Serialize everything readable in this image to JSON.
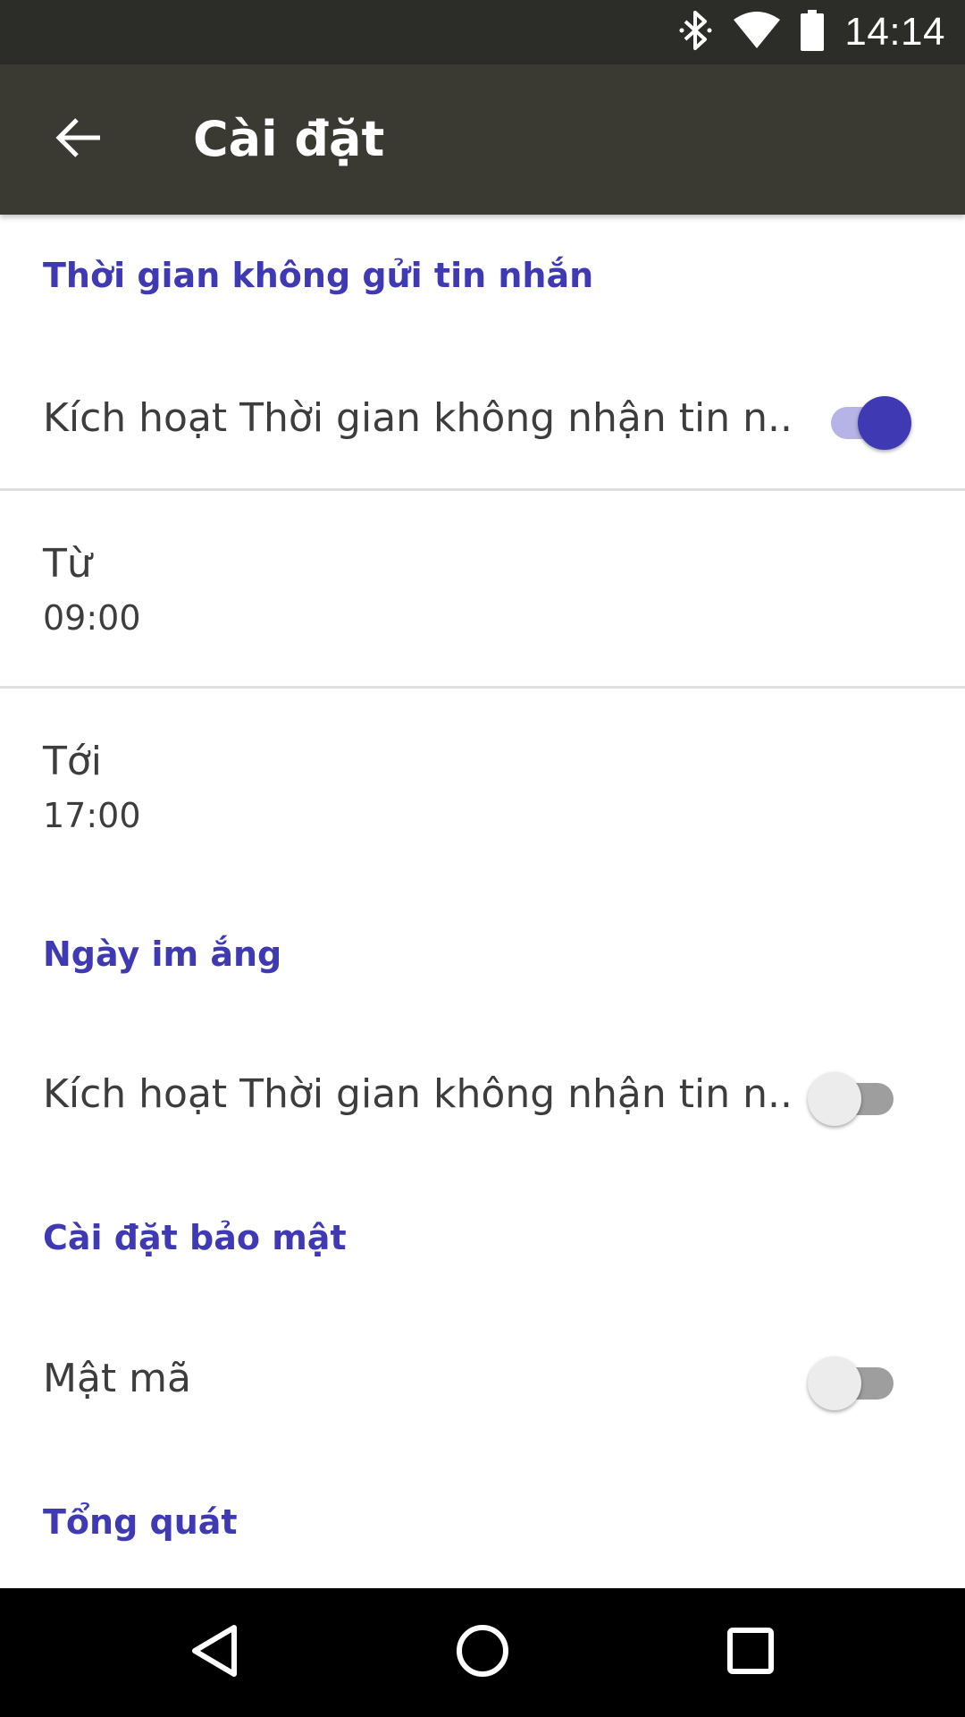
{
  "status_bar": {
    "time": "14:14",
    "icons": [
      "bluetooth-icon",
      "wifi-icon",
      "battery-icon"
    ]
  },
  "app_bar": {
    "title": "Cài đặt",
    "back_icon": "arrow-back-icon"
  },
  "sections": {
    "no_message_time": {
      "header": "Thời gian không gửi tin nhắn",
      "toggle_label": "Kích hoạt Thời gian không nhận tin n..",
      "toggle_on": true,
      "from_label": "Từ",
      "from_value": "09:00",
      "to_label": "Tới",
      "to_value": "17:00"
    },
    "quiet_day": {
      "header": "Ngày im ắng",
      "toggle_label": "Kích hoạt Thời gian không nhận tin n..",
      "toggle_on": false
    },
    "security": {
      "header": "Cài đặt bảo mật",
      "password_label": "Mật mã",
      "toggle_on": false
    },
    "general": {
      "header": "Tổng quát"
    }
  },
  "nav_bar": {
    "icons": [
      "back-triangle-icon",
      "home-circle-icon",
      "recents-square-icon"
    ]
  },
  "colors": {
    "accent": "#3f3ab4",
    "app_bar": "#3a3a33",
    "status_bar": "#2c2c28"
  }
}
